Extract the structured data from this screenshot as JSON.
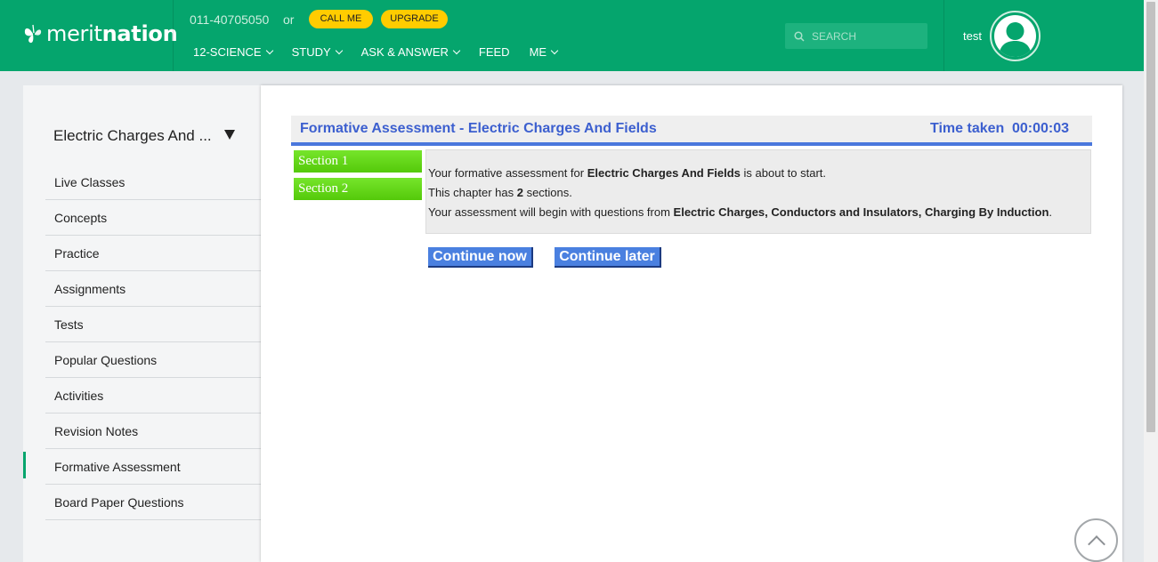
{
  "header": {
    "logo_text_regular": "merit",
    "logo_text_bold": "nation",
    "phone": "011-40705050",
    "or_text": "or",
    "call_label": "CALL ME",
    "upgrade_label": "UPGRADE",
    "nav": [
      {
        "label": "12-SCIENCE",
        "has_dropdown": true
      },
      {
        "label": "STUDY",
        "has_dropdown": true
      },
      {
        "label": "ASK & ANSWER",
        "has_dropdown": true
      },
      {
        "label": "FEED",
        "has_dropdown": false
      },
      {
        "label": "ME",
        "has_dropdown": true
      }
    ],
    "search_placeholder": "SEARCH",
    "username": "test",
    "brand_color": "#05a56d",
    "button_color": "#ffcc00"
  },
  "sidebar": {
    "chapter_title": "Electric Charges And ...",
    "items": [
      {
        "label": "Live Classes"
      },
      {
        "label": "Concepts"
      },
      {
        "label": "Practice"
      },
      {
        "label": "Assignments"
      },
      {
        "label": "Tests"
      },
      {
        "label": "Popular Questions"
      },
      {
        "label": "Activities"
      },
      {
        "label": "Revision Notes"
      },
      {
        "label": "Formative Assessment",
        "active": true
      },
      {
        "label": "Board Paper Questions"
      }
    ]
  },
  "assessment": {
    "title": "Formative Assessment - Electric Charges And Fields",
    "time_label": "Time taken",
    "time_value": "00:00:03",
    "sections": [
      "Section 1",
      "Section 2"
    ],
    "line1_pre": "Your formative assessment for ",
    "line1_bold": "Electric Charges And Fields",
    "line1_post": " is about to start.",
    "line2_pre": "This chapter has ",
    "line2_bold": "2",
    "line2_post": " sections.",
    "line3_pre": "Your assessment will begin with questions from ",
    "line3_bold": "Electric Charges, Conductors and Insulators, Charging By Induction",
    "line3_post": ".",
    "continue_now": "Continue now",
    "continue_later": "Continue later",
    "accent_color": "#3c5fcf"
  }
}
